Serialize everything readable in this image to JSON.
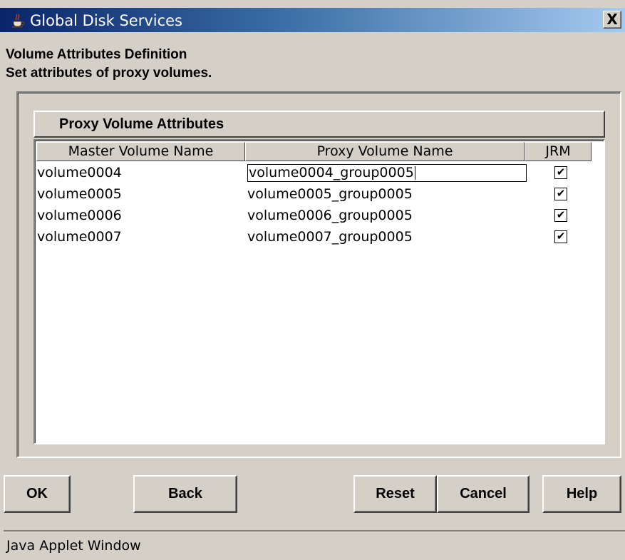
{
  "window": {
    "title": "Global Disk Services",
    "close_label": "X"
  },
  "header": {
    "title": "Volume Attributes Definition",
    "subtitle": "Set attributes of proxy volumes."
  },
  "attributes_panel": {
    "title": "Proxy Volume Attributes",
    "columns": [
      "Master Volume Name",
      "Proxy Volume Name",
      "JRM"
    ],
    "rows": [
      {
        "master": "volume0004",
        "proxy": "volume0004_group0005",
        "jrm": true,
        "editing": true
      },
      {
        "master": "volume0005",
        "proxy": "volume0005_group0005",
        "jrm": true
      },
      {
        "master": "volume0006",
        "proxy": "volume0006_group0005",
        "jrm": true
      },
      {
        "master": "volume0007",
        "proxy": "volume0007_group0005",
        "jrm": true
      }
    ]
  },
  "buttons": {
    "ok": "OK",
    "back": "Back",
    "reset": "Reset",
    "cancel": "Cancel",
    "help": "Help"
  },
  "status": {
    "text": "Java Applet Window"
  },
  "icons": {
    "title_icon": "java-cup-icon",
    "check": "checkmark-icon"
  }
}
